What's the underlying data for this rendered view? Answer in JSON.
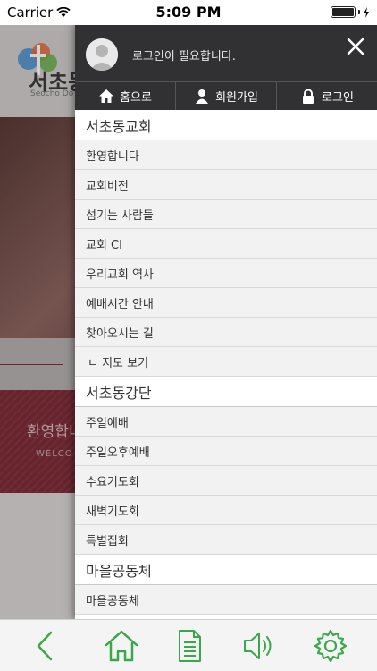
{
  "status": {
    "carrier": "Carrier",
    "time": "5:09 PM"
  },
  "background": {
    "title": "서초동",
    "subtitle": "Seocho Do",
    "welcome": "환영합니",
    "welcome_en": "WELCO"
  },
  "drawer": {
    "login_message": "로그인이 필요합니다.",
    "nav": [
      {
        "label": "홈으로",
        "icon": "home-icon"
      },
      {
        "label": "회원가입",
        "icon": "person-icon"
      },
      {
        "label": "로그인",
        "icon": "lock-icon"
      }
    ],
    "menu": [
      {
        "type": "section",
        "label": "서초동교회"
      },
      {
        "type": "item",
        "label": "환영합니다"
      },
      {
        "type": "item",
        "label": "교회비전"
      },
      {
        "type": "item",
        "label": "섬기는 사람들"
      },
      {
        "type": "item",
        "label": "교회 CI"
      },
      {
        "type": "item",
        "label": "우리교회 역사"
      },
      {
        "type": "item",
        "label": "예배시간 안내"
      },
      {
        "type": "item",
        "label": "찾아오시는 길"
      },
      {
        "type": "sub",
        "label": "ㄴ 지도 보기"
      },
      {
        "type": "section",
        "label": "서초동강단"
      },
      {
        "type": "item",
        "label": "주일예배"
      },
      {
        "type": "item",
        "label": "주일오후예배"
      },
      {
        "type": "item",
        "label": "수요기도회"
      },
      {
        "type": "item",
        "label": "새벽기도회"
      },
      {
        "type": "item",
        "label": "특별집회"
      },
      {
        "type": "section",
        "label": "마을공동체"
      },
      {
        "type": "item",
        "label": "마을공동체"
      }
    ]
  },
  "tabbar": {
    "accent": "#3aa84a",
    "icons": [
      "back-icon",
      "home-icon",
      "document-icon",
      "speaker-icon",
      "settings-icon"
    ]
  }
}
